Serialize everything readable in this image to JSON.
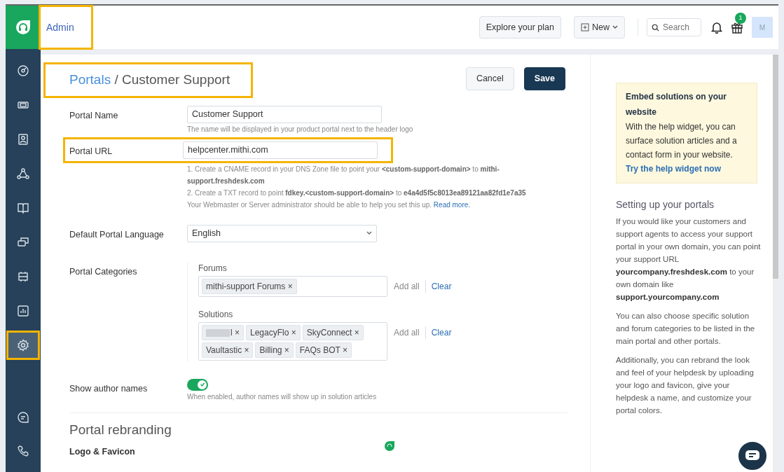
{
  "sidebar": {
    "items": [
      {
        "kind": "dashboard",
        "selected": false,
        "highlighted": false
      },
      {
        "kind": "ticket",
        "selected": false,
        "highlighted": false
      },
      {
        "kind": "contact",
        "selected": false,
        "highlighted": false
      },
      {
        "kind": "network",
        "selected": false,
        "highlighted": false
      },
      {
        "kind": "book",
        "selected": false,
        "highlighted": false
      },
      {
        "kind": "chats",
        "selected": false,
        "highlighted": false
      },
      {
        "kind": "board",
        "selected": false,
        "highlighted": false
      },
      {
        "kind": "report",
        "selected": false,
        "highlighted": false
      },
      {
        "kind": "gear",
        "selected": true,
        "highlighted": true
      }
    ],
    "bottom_items": [
      {
        "kind": "chat"
      },
      {
        "kind": "phone"
      }
    ]
  },
  "header": {
    "title": "Admin",
    "title_highlighted": true,
    "explore_button": "Explore your plan",
    "new_button": "New",
    "search": {
      "placeholder": "Search"
    },
    "gift_badge": "1",
    "avatar": "M"
  },
  "page": {
    "breadcrumb": [
      {
        "label": "Portals",
        "link": true
      },
      {
        "label": " / Customer Support",
        "link": false
      }
    ],
    "breadcrumb_highlighted": true,
    "cancel": "Cancel",
    "save": "Save",
    "portal_name": {
      "label": "Portal Name",
      "value": "Customer Support",
      "hint": "The name will be displayed in your product portal next to the header logo",
      "highlighted": false
    },
    "portal_url": {
      "label": "Portal URL",
      "value": "helpcenter.mithi.com",
      "highlighted": true,
      "notes": [
        "1. Create a CNAME record in your DNS Zone file to point your **<custom-support-domain>** to **mithi-support.freshdesk.com**",
        "2. Create a TXT record to point **fdkey.<custom-support-domain>** to **e4a4d5f5c8013ea89121aa82fd1e7a35**"
      ],
      "help_text": "Your Webmaster or Server administrator should be able to help you set this up.",
      "help_link": "Read more."
    },
    "language": {
      "label": "Default Portal Language",
      "value": "English"
    },
    "categories": {
      "label": "Portal Categories",
      "groups": [
        {
          "label": "Forums",
          "tags": [
            {
              "text": "mithi-support Forums",
              "redacted": false,
              "remove": "×"
            }
          ],
          "add_all": "Add all",
          "clear": "Clear"
        },
        {
          "label": "Solutions",
          "tags": [
            {
              "text": "l",
              "redacted": true,
              "remove": "×"
            },
            {
              "text": "LegacyFlo",
              "redacted": false,
              "remove": "×"
            },
            {
              "text": "SkyConnect",
              "redacted": false,
              "remove": "×"
            },
            {
              "text": "Vaultastic",
              "redacted": false,
              "remove": "×"
            },
            {
              "text": "Billing",
              "redacted": false,
              "remove": "×"
            },
            {
              "text": "FAQs BOT",
              "redacted": false,
              "remove": "×"
            }
          ],
          "add_all": "Add all",
          "clear": "Clear"
        }
      ]
    },
    "author_names": {
      "label": "Show author names",
      "on": true,
      "hint": "When enabled, author names will show up in solution articles"
    },
    "rebranding": {
      "heading": "Portal rebranding",
      "logo_label": "Logo & Favicon"
    }
  },
  "side_panel": {
    "promo": {
      "title": "Embed solutions on your website",
      "text": "With the help widget, you can surface solution articles and a contact form in your website.",
      "link": "Try the help widget now"
    },
    "heading": "Setting up your portals",
    "paragraphs": [
      "If you would like your customers and support agents to access your support portal in your own domain, you can point your support URL **yourcompany.freshdesk.com** to your own domain like **support.yourcompany.com**",
      "You can also choose specific solution and forum categories to be listed in the main portal and other portals.",
      "Additionally, you can rebrand the look and feel of your helpdesk by uploading your logo and favicon, give your helpdesk a name, and customize your portal colors."
    ]
  }
}
